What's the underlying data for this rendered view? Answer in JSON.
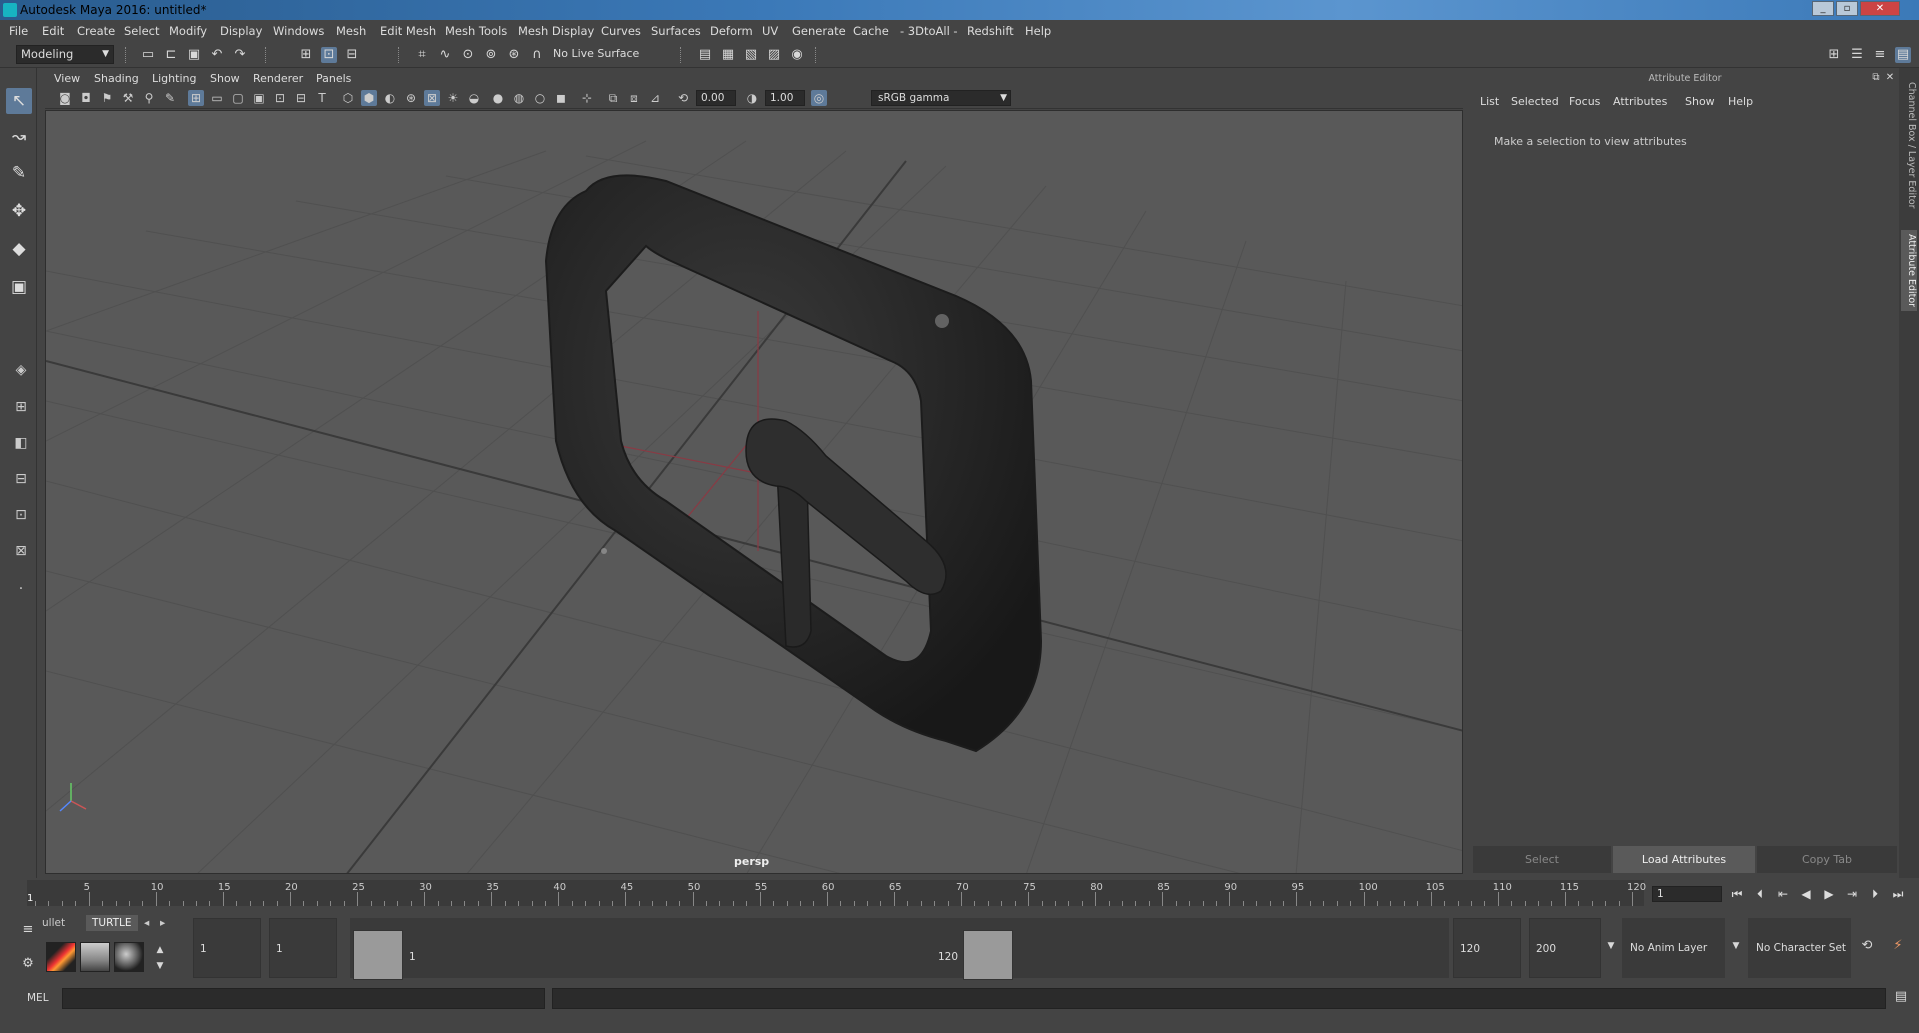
{
  "window": {
    "title": "Autodesk Maya 2016: untitled*"
  },
  "menubar": [
    "File",
    "Edit",
    "Create",
    "Select",
    "Modify",
    "Display",
    "Windows",
    "Mesh",
    "Edit Mesh",
    "Mesh Tools",
    "Mesh Display",
    "Curves",
    "Surfaces",
    "Deform",
    "UV",
    "Generate",
    "Cache",
    "- 3DtoAll -",
    "Redshift",
    "Help"
  ],
  "statusline": {
    "mode": "Modeling",
    "live_surface": "No Live Surface"
  },
  "viewport": {
    "menu": [
      "View",
      "Shading",
      "Lighting",
      "Show",
      "Renderer",
      "Panels"
    ],
    "exposure": "0.00",
    "gamma_value": "1.00",
    "color_space": "sRGB gamma",
    "camera": "persp"
  },
  "attribute_editor": {
    "header": "Attribute Editor",
    "menu": [
      "List",
      "Selected",
      "Focus",
      "Attributes",
      "Show",
      "Help"
    ],
    "message": "Make a selection to view attributes",
    "buttons": {
      "select": "Select",
      "load": "Load Attributes",
      "copy": "Copy Tab"
    },
    "side_tabs": [
      "Channel Box / Layer Editor",
      "Attribute Editor"
    ]
  },
  "timeslider": {
    "labels": [
      "5",
      "10",
      "15",
      "20",
      "25",
      "30",
      "35",
      "40",
      "45",
      "50",
      "55",
      "60",
      "65",
      "70",
      "75",
      "80",
      "85",
      "90",
      "95",
      "100",
      "105",
      "110",
      "115",
      "120"
    ],
    "current_frame_marker": "1",
    "current_frame": "1"
  },
  "shelf": {
    "tabs": [
      "ullet",
      "TURTLE"
    ]
  },
  "range": {
    "start": "1",
    "playback_start": "1",
    "handle_start": "1",
    "handle_end": "120",
    "playback_end": "120",
    "end": "200",
    "anim_layer": "No Anim Layer",
    "character_set": "No Character Set"
  },
  "cmdline": {
    "label": "MEL"
  },
  "colors": {
    "accent": "#5e7a99",
    "maya_teal": "#25c4c7",
    "viewport_bg": "#595959"
  }
}
